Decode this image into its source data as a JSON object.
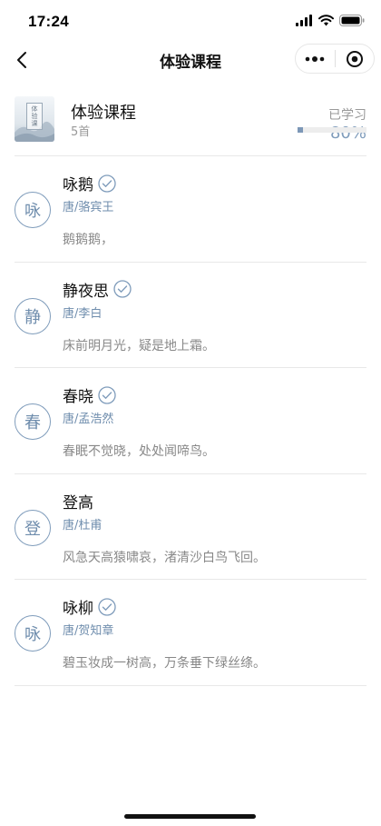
{
  "status_bar": {
    "time": "17:24"
  },
  "nav": {
    "title": "体验课程"
  },
  "course": {
    "cover_text": "体验课",
    "title": "体验课程",
    "count": "5首",
    "progress_label": "已学习",
    "progress_value": "80%",
    "progress_fraction": 0.08
  },
  "poems": [
    {
      "avatar": "咏",
      "title": "咏鹅",
      "author": "唐/骆宾王",
      "line": "鹅鹅鹅，",
      "completed": true
    },
    {
      "avatar": "静",
      "title": "静夜思",
      "author": "唐/李白",
      "line": "床前明月光，疑是地上霜。",
      "completed": true
    },
    {
      "avatar": "春",
      "title": "春晓",
      "author": "唐/孟浩然",
      "line": "春眠不觉晓，处处闻啼鸟。",
      "completed": true
    },
    {
      "avatar": "登",
      "title": "登高",
      "author": "唐/杜甫",
      "line": "风急天高猿啸哀，渚清沙白鸟飞回。",
      "completed": false
    },
    {
      "avatar": "咏",
      "title": "咏柳",
      "author": "唐/贺知章",
      "line": "碧玉妆成一树高，万条垂下绿丝绦。",
      "completed": true
    }
  ],
  "colors": {
    "accent": "#7f9cbb",
    "divider": "#e8e8e8",
    "muted_text": "#888888"
  }
}
